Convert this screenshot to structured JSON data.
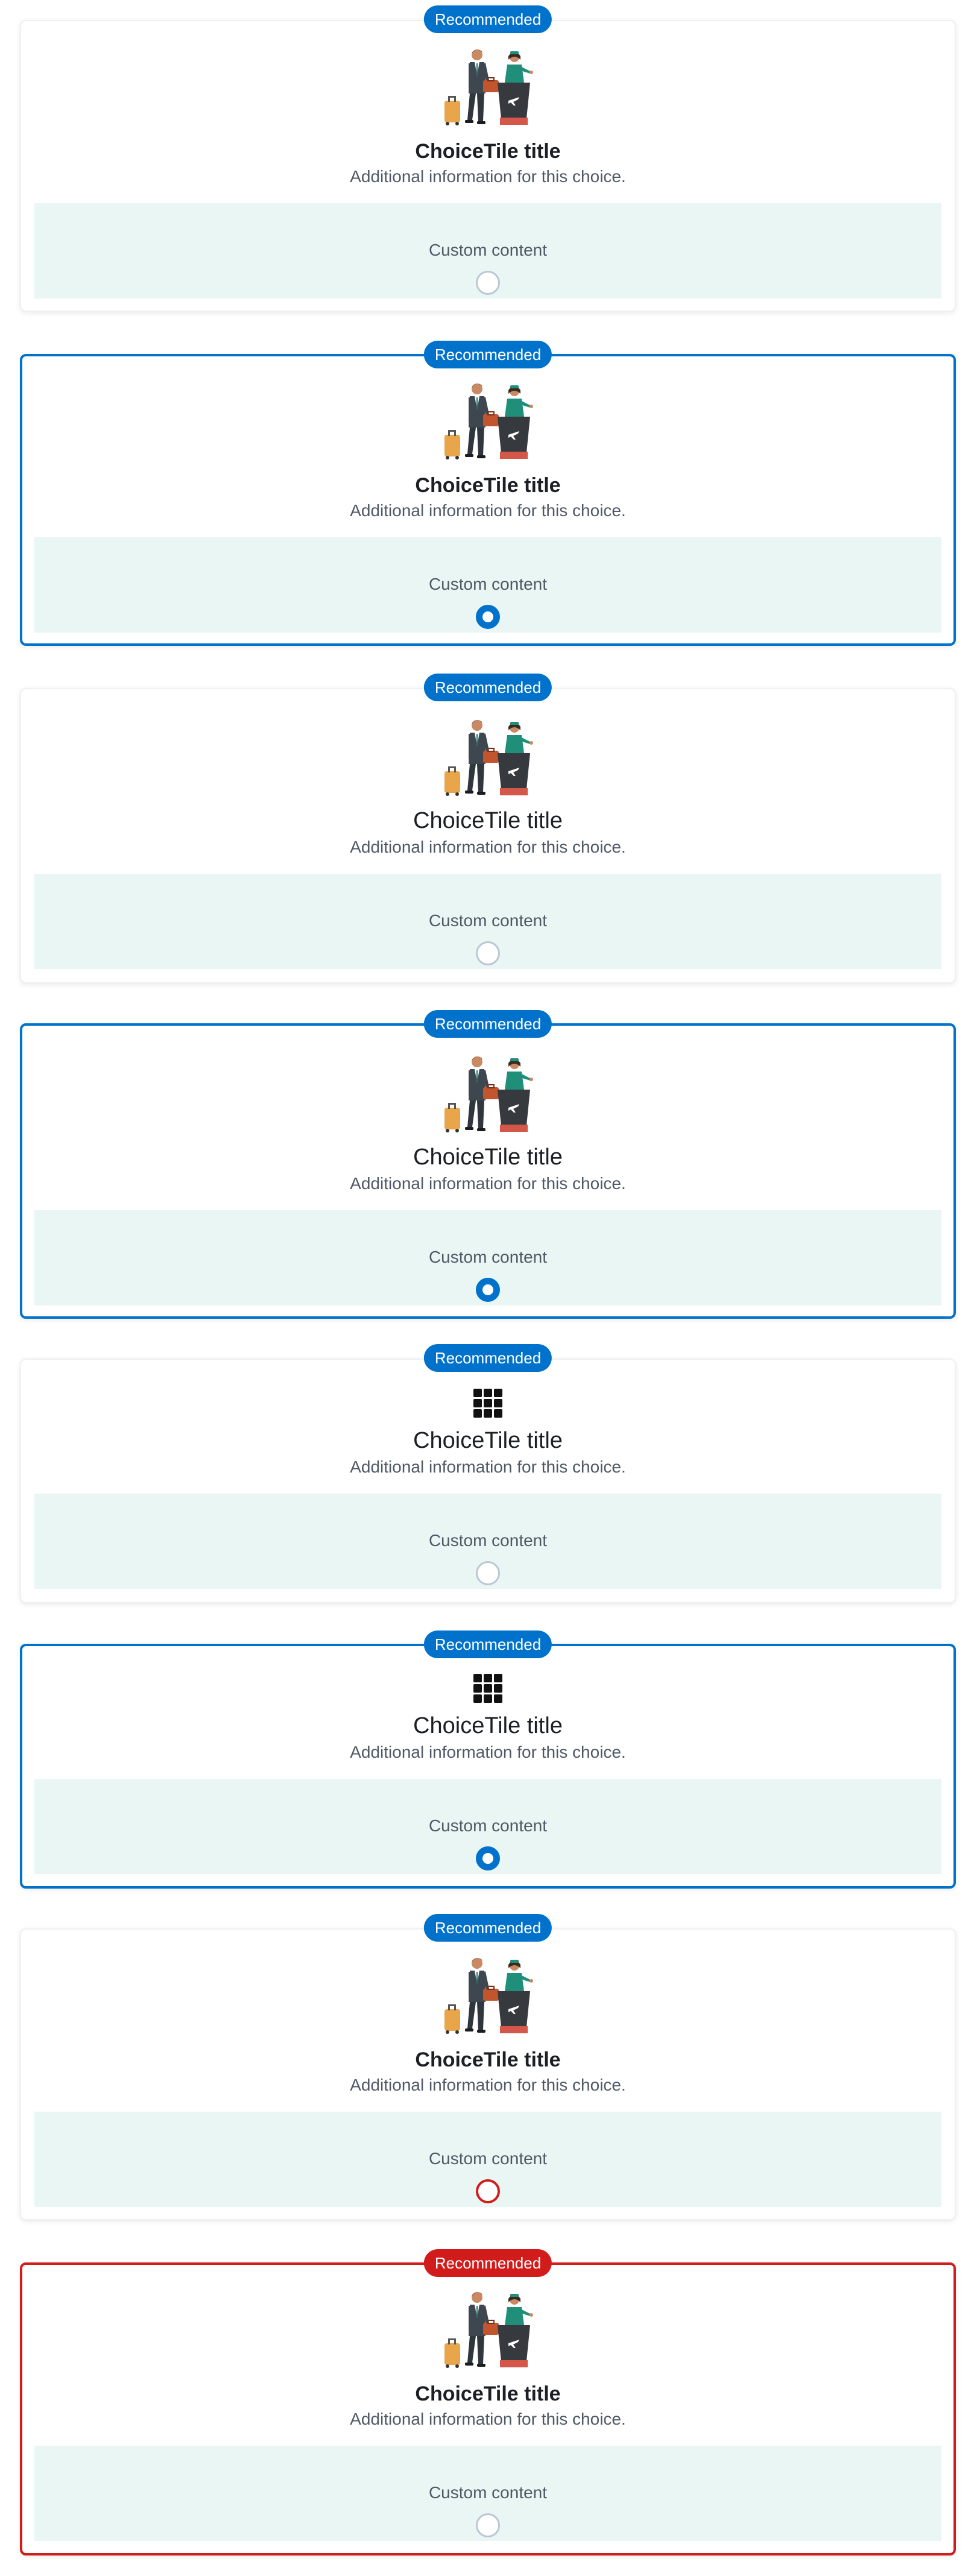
{
  "tiles": [
    {
      "badge": "Recommended",
      "title": "ChoiceTile title",
      "description": "Additional information for this choice.",
      "custom": "Custom content"
    },
    {
      "badge": "Recommended",
      "title": "ChoiceTile title",
      "description": "Additional information for this choice.",
      "custom": "Custom content"
    },
    {
      "badge": "Recommended",
      "title": "ChoiceTile title",
      "description": "Additional information for this choice.",
      "custom": "Custom content"
    },
    {
      "badge": "Recommended",
      "title": "ChoiceTile title",
      "description": "Additional information for this choice.",
      "custom": "Custom content"
    },
    {
      "badge": "Recommended",
      "title": "ChoiceTile title",
      "description": "Additional information for this choice.",
      "custom": "Custom content"
    },
    {
      "badge": "Recommended",
      "title": "ChoiceTile title",
      "description": "Additional information for this choice.",
      "custom": "Custom content"
    },
    {
      "badge": "Recommended",
      "title": "ChoiceTile title",
      "description": "Additional information for this choice.",
      "custom": "Custom content"
    },
    {
      "badge": "Recommended",
      "title": "ChoiceTile title",
      "description": "Additional information for this choice.",
      "custom": "Custom content"
    }
  ],
  "colors": {
    "primary": "#0172cb",
    "critical": "#d21c1c",
    "custom_bg": "#e9f6f3",
    "radio_border": "#bac7d5"
  },
  "icons": {
    "illustration": "airport-checkin-illustration",
    "grid": "grid-icon"
  }
}
